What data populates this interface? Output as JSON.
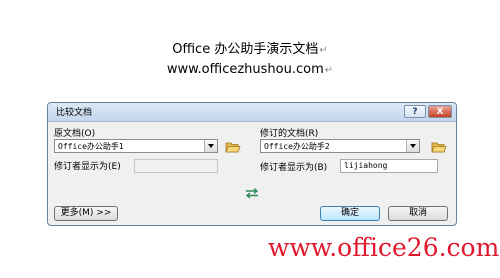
{
  "document": {
    "title": "Office 办公助手演示文档",
    "url": "www.officezhushou.com",
    "para_mark": "↵"
  },
  "dialog": {
    "title": "比较文档",
    "help_label": "?",
    "close_label": "X",
    "original": {
      "label": "原文档(O)",
      "value": "Office办公助手1",
      "reviewer_label": "修订者显示为(E)",
      "reviewer_value": ""
    },
    "revised": {
      "label": "修订的文档(R)",
      "value": "Office办公助手2",
      "reviewer_label": "修订者显示为(B)",
      "reviewer_value": "lijiahong"
    },
    "buttons": {
      "more": "更多(M) >>",
      "ok": "确定",
      "cancel": "取消"
    }
  },
  "watermark": "www.office26.com",
  "colors": {
    "watermark": "#e0192e",
    "titlebar": "#c4d7ee",
    "folder": "#e8b84a",
    "swap_arrows": "#2e8b57"
  },
  "icons": [
    "folder-open-icon",
    "swap-arrows-icon",
    "help-icon",
    "close-icon",
    "chevron-down-icon"
  ]
}
